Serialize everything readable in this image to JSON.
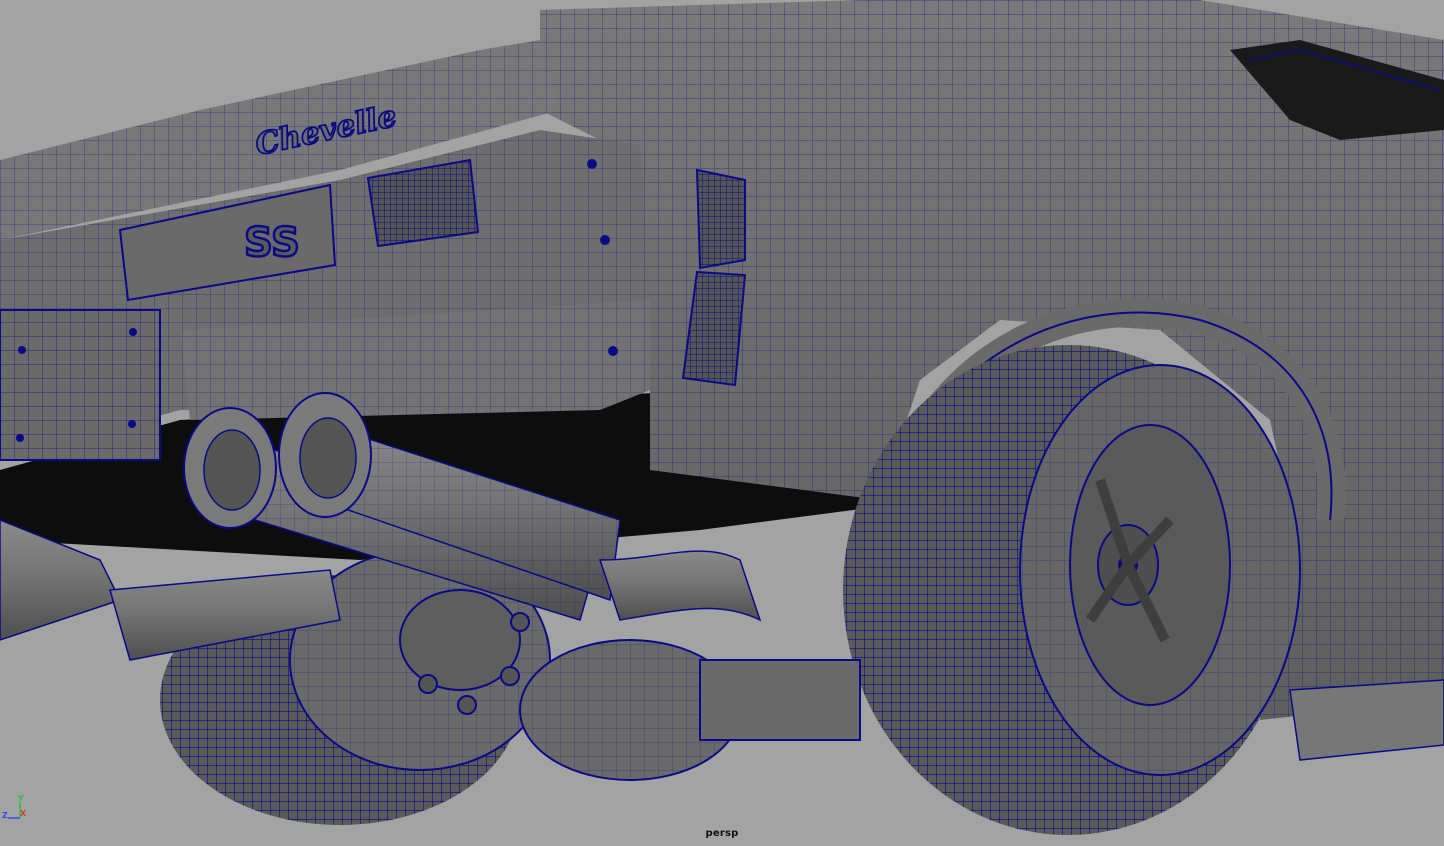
{
  "viewport": {
    "camera_name": "persp",
    "background_color": "#a3a3a3",
    "shade_color": "#6f6f6f",
    "wire_color": "#0a0a86",
    "badge_text": "SS",
    "script_logo_text": "Chevelle"
  },
  "axis_gizmo": {
    "y_label": "Y",
    "z_label": "Z",
    "x_label": "X",
    "y_color": "#2ec02e",
    "z_color": "#2f4fd8",
    "x_color": "#d23a2a"
  }
}
